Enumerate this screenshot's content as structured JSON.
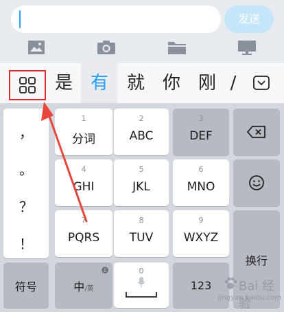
{
  "input_bar": {
    "send_label": "发送"
  },
  "media_icons": [
    "image-icon",
    "camera-icon",
    "folder-icon",
    "desktop-icon"
  ],
  "candidates": [
    "是",
    "有",
    "就",
    "你",
    "刚",
    "/"
  ],
  "punctuation": [
    "，",
    "。",
    "？",
    "！"
  ],
  "keys": [
    {
      "num": "1",
      "label": "分词"
    },
    {
      "num": "2",
      "label": "ABC"
    },
    {
      "num": "3",
      "label": "DEF"
    },
    {
      "num": "4",
      "label": "GHI"
    },
    {
      "num": "5",
      "label": "JKL"
    },
    {
      "num": "6",
      "label": "MNO"
    },
    {
      "num": "7",
      "label": "PQRS"
    },
    {
      "num": "8",
      "label": "TUV"
    },
    {
      "num": "9",
      "label": "WXYZ"
    }
  ],
  "bottom": {
    "symbol_label": "符号",
    "lang_main": "中",
    "lang_alt": "/英",
    "space_num": "0",
    "num_label": "123",
    "newline_label": "换行"
  },
  "watermark": {
    "text": "Bai 经验",
    "url": "jingyan.baidu.com"
  },
  "colors": {
    "accent": "#2b9df4",
    "highlight_box": "#e0282f",
    "arrow": "#e8453c"
  }
}
